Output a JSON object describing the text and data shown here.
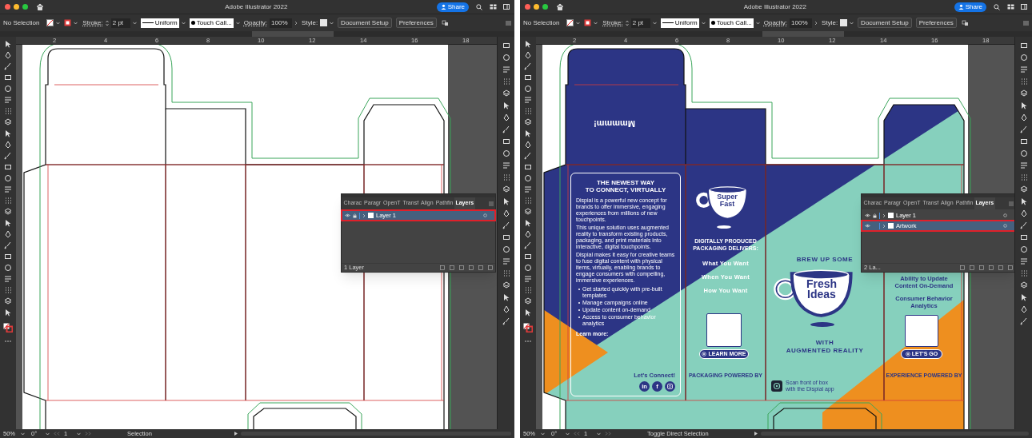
{
  "panes": [
    {
      "window": {
        "title": "Adobe Illustrator 2022"
      },
      "share_label": "Share",
      "control_bar": {
        "selection": "No Selection",
        "stroke_label": "Stroke:",
        "stroke_weight": "2 pt",
        "profile": "Uniform",
        "brush": "Touch Call...",
        "opacity_label": "Opacity:",
        "opacity": "100%",
        "style_label": "Style:",
        "buttons": [
          "Document Setup",
          "Preferences"
        ]
      },
      "ruler_marks": [
        "2",
        "4",
        "6",
        "8",
        "10",
        "12",
        "14",
        "16",
        "18"
      ],
      "artwork": {
        "kind": "dieline"
      },
      "layers_panel": {
        "tabs": [
          {
            "label": "Charac",
            "selected": false
          },
          {
            "label": "Paragr",
            "selected": false
          },
          {
            "label": "OpenT",
            "selected": false
          },
          {
            "label": "Transf",
            "selected": false
          },
          {
            "label": "Align",
            "selected": false
          },
          {
            "label": "Pathfin",
            "selected": false
          },
          {
            "label": "Layers",
            "selected": true
          }
        ],
        "layers": [
          {
            "name": "Layer 1",
            "locked": true,
            "selected": true
          }
        ],
        "footer": "1 Layer"
      },
      "status_bar": {
        "zoom": "50%",
        "rotation": "0°",
        "artboard": "1",
        "tool": "Selection"
      }
    },
    {
      "window": {
        "title": "Adobe Illustrator 2022"
      },
      "share_label": "Share",
      "control_bar": {
        "selection": "No Selection",
        "stroke_label": "Stroke:",
        "stroke_weight": "2 pt",
        "profile": "Uniform",
        "brush": "Touch Call...",
        "opacity_label": "Opacity:",
        "opacity": "100%",
        "style_label": "Style:",
        "buttons": [
          "Document Setup",
          "Preferences"
        ]
      },
      "ruler_marks": [
        "2",
        "4",
        "6",
        "8",
        "10",
        "12",
        "14",
        "16",
        "18"
      ],
      "artwork": {
        "kind": "printed",
        "flap_text": "Mmmmm!",
        "info_card": {
          "heading": "THE NEWEST WAY\nTO CONNECT, VIRTUALLY",
          "paragraphs": [
            "Dispial is a powerful new concept for brands to offer immersive, engaging experiences from millions of new touchpoints.",
            "This unique solution uses augmented reality to transform existing products, packaging, and print materials into interactive, digital touchpoints.",
            "Dispial makes it easy for creative teams to fuse digital content with physical items, virtually, enabling brands to engage consumers with compelling, immersive experiences."
          ],
          "bullets": [
            "Get started quickly with pre-built templates",
            "Manage campaigns online",
            "Update content on-demand",
            "Access to consumer behavior analytics"
          ],
          "link": "Learn more:",
          "social_heading": "Let's Connect!",
          "social_links": [
            {
              "kind": "text",
              "label": "in"
            },
            {
              "kind": "text",
              "label": "f"
            },
            {
              "kind": "camera"
            }
          ]
        },
        "panel_2": {
          "cup_text": "Super\nFast",
          "heading": "DIGITALLY PRODUCED\nPACKAGING DELIVERS:",
          "lines": [
            "What You Want",
            "When You Want",
            "How You Want"
          ],
          "button": "LEARN MORE",
          "footer": "PACKAGING POWERED BY"
        },
        "panel_3": {
          "heading": "BREW UP SOME",
          "cup_text": "Fresh\nIdeas",
          "subheading": "WITH\nAUGMENTED REALITY",
          "scan_note": "Scan front of box\nwith the Dispial app"
        },
        "panel_4": {
          "lines": [
            "Ability to Update\nContent On-Demand",
            "Consumer Behavior\nAnalytics"
          ],
          "button": "LET'S GO",
          "footer": "EXPERIENCE POWERED BY"
        }
      },
      "layers_panel": {
        "tabs": [
          {
            "label": "Charac",
            "selected": false
          },
          {
            "label": "Paragr",
            "selected": false
          },
          {
            "label": "OpenT",
            "selected": false
          },
          {
            "label": "Transf",
            "selected": false
          },
          {
            "label": "Align",
            "selected": false
          },
          {
            "label": "Pathfin",
            "selected": false
          },
          {
            "label": "Layers",
            "selected": true
          }
        ],
        "layers": [
          {
            "name": "Layer 1",
            "locked": true,
            "selected": false
          },
          {
            "name": "Artwork",
            "locked": false,
            "selected": true
          }
        ],
        "footer": "2 La..."
      },
      "status_bar": {
        "zoom": "50%",
        "rotation": "0°",
        "artboard": "1",
        "tool": "Toggle Direct Selection"
      }
    }
  ]
}
